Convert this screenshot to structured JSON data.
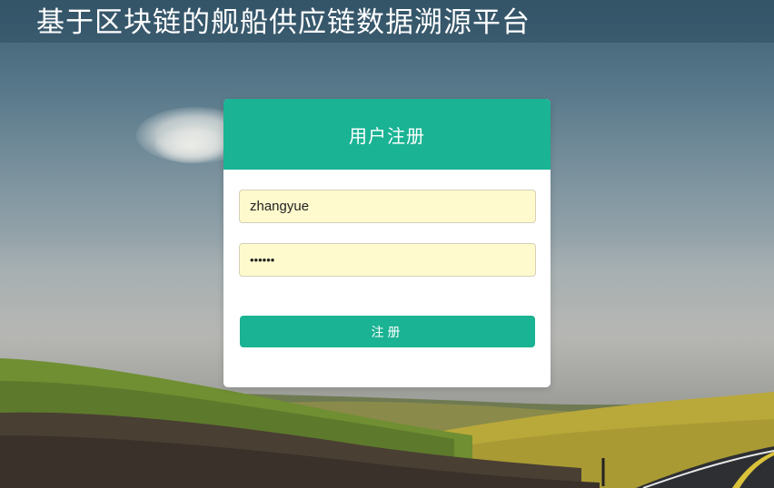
{
  "header": {
    "title": "基于区块链的舰船供应链数据溯源平台"
  },
  "register_form": {
    "title": "用户注册",
    "username_value": "zhangyue",
    "password_value": "••••••",
    "submit_label": "注册"
  },
  "colors": {
    "accent": "#1ab394",
    "input_background": "#fffacd",
    "title_bar": "#28465a"
  }
}
